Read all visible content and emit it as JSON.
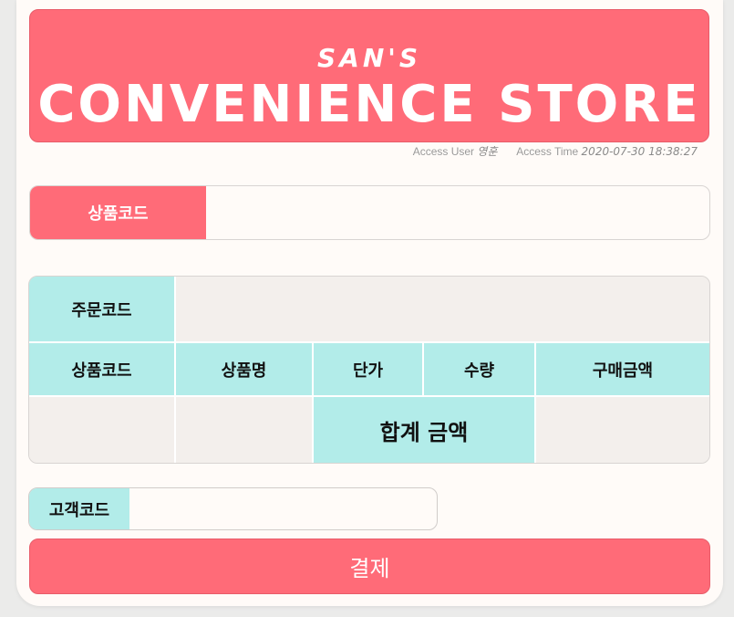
{
  "header": {
    "subtitle": "SAN'S",
    "title": "CONVENIENCE STORE",
    "access_user_label": "Access User",
    "access_user": "영훈",
    "access_time_label": "Access Time",
    "access_time": "2020-07-30 18:38:27"
  },
  "product_code": {
    "label": "상품코드",
    "value": ""
  },
  "order_table": {
    "order_code_label": "주문코드",
    "order_code_value": "",
    "columns": [
      "상품코드",
      "상품명",
      "단가",
      "수량",
      "구매금액"
    ],
    "total_label": "합계 금액",
    "row_product_code": "",
    "row_product_name": "",
    "total_value": ""
  },
  "customer_code": {
    "label": "고객코드",
    "value": ""
  },
  "pay_button": {
    "label": "결제"
  },
  "colors": {
    "accent": "#ff6b78",
    "header_cell": "#b2ece9",
    "body_cell": "#f3efec"
  }
}
